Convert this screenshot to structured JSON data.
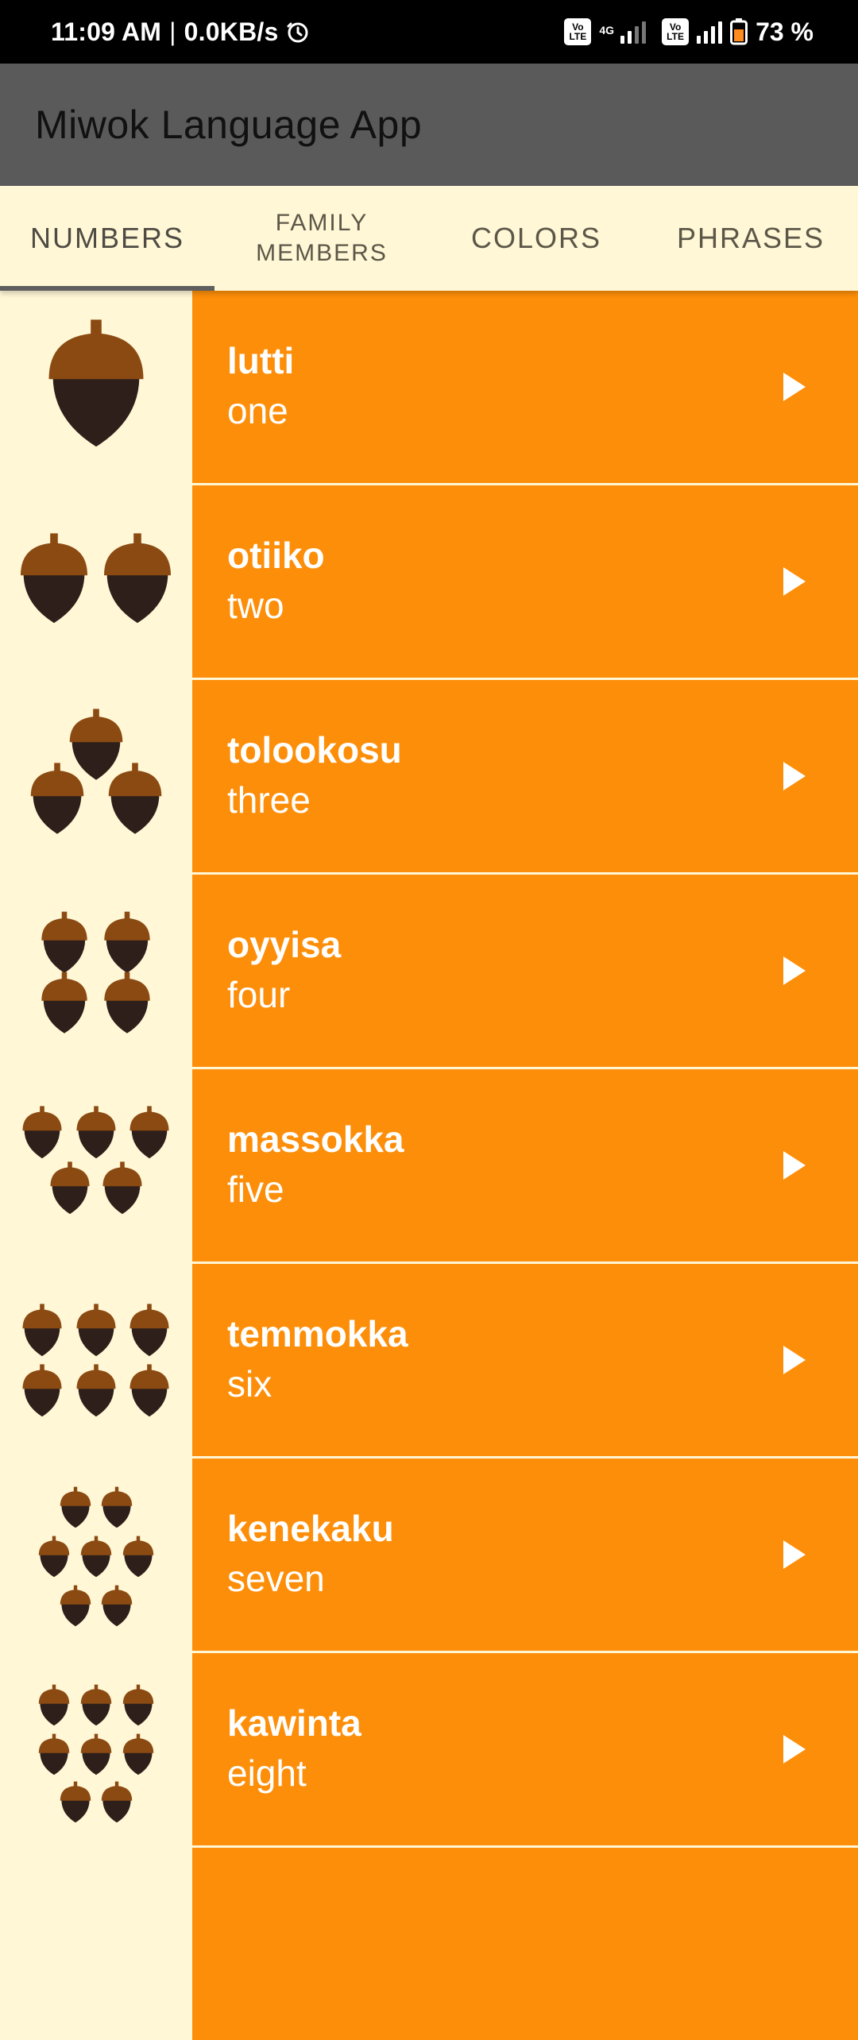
{
  "status_bar": {
    "time": "11:09 AM",
    "separator": "|",
    "speed": "0.0KB/s",
    "battery_text": "73 %",
    "net_label": "4G",
    "volte": "Vo LTE",
    "icons": [
      "alarm-icon",
      "volte-icon",
      "signal-icon",
      "battery-icon"
    ]
  },
  "app_bar": {
    "title": "Miwok Language App",
    "background_color": "#5A5A5A"
  },
  "tabs": [
    {
      "label": "NUMBERS",
      "active": true
    },
    {
      "label": "FAMILY\nMEMBERS",
      "active": false
    },
    {
      "label": "COLORS",
      "active": false
    },
    {
      "label": "PHRASES",
      "active": false
    }
  ],
  "words": [
    {
      "miwok": "lutti",
      "english": "one",
      "acorns": 1,
      "icon": "acorn-one-icon"
    },
    {
      "miwok": "otiiko",
      "english": "two",
      "acorns": 2,
      "icon": "acorn-two-icon"
    },
    {
      "miwok": "tolookosu",
      "english": "three",
      "acorns": 3,
      "icon": "acorn-three-icon"
    },
    {
      "miwok": "oyyisa",
      "english": "four",
      "acorns": 4,
      "icon": "acorn-four-icon"
    },
    {
      "miwok": "massokka",
      "english": "five",
      "acorns": 5,
      "icon": "acorn-five-icon"
    },
    {
      "miwok": "temmokka",
      "english": "six",
      "acorns": 6,
      "icon": "acorn-six-icon"
    },
    {
      "miwok": "kenekaku",
      "english": "seven",
      "acorns": 7,
      "icon": "acorn-seven-icon"
    },
    {
      "miwok": "kawinta",
      "english": "eight",
      "acorns": 8,
      "icon": "acorn-eight-icon"
    }
  ],
  "colors": {
    "row_background": "#FD8E09",
    "image_background": "#FFF7D6",
    "acorn_cap": "#8B4A12",
    "acorn_body": "#2E1F1A"
  }
}
